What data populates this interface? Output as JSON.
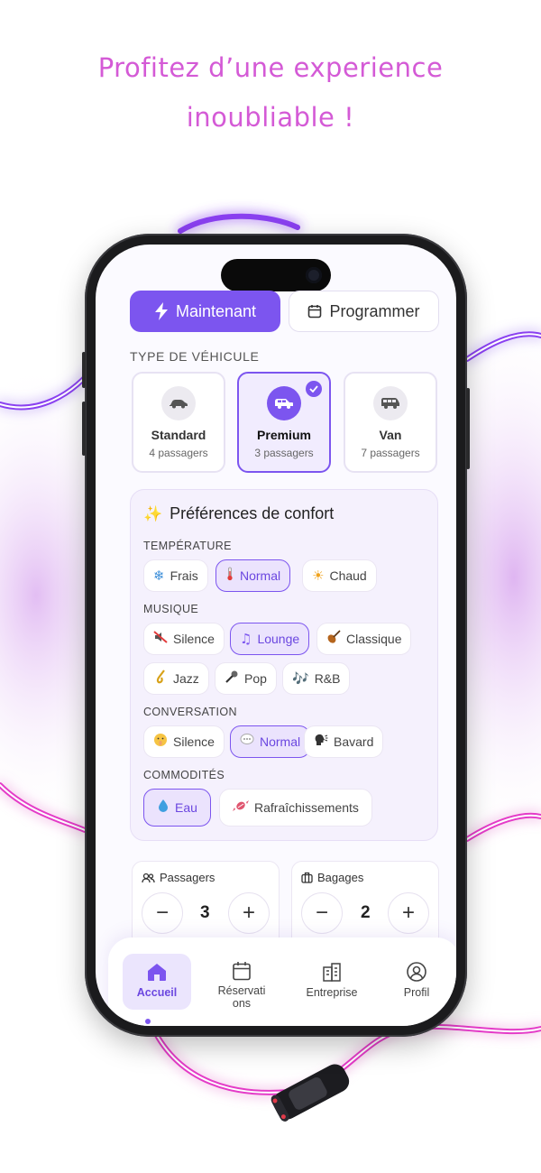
{
  "headline": {
    "line1": "Profitez d’une experience",
    "line2": "inoubliable !"
  },
  "mode": {
    "now_label": "Maintenant",
    "schedule_label": "Programmer",
    "selected": "Maintenant"
  },
  "vehicle": {
    "section_label": "TYPE DE VÉHICULE",
    "selected": "Premium",
    "options": [
      {
        "name": "Standard",
        "sub": "4 passagers",
        "icon": "car-icon"
      },
      {
        "name": "Premium",
        "sub": "3 passagers",
        "icon": "suv-icon"
      },
      {
        "name": "Van",
        "sub": "7 passagers",
        "icon": "van-icon"
      }
    ]
  },
  "prefs": {
    "title": "Préférences de confort",
    "title_emoji": "✨",
    "temperature": {
      "label": "TEMPÉRATURE",
      "selected": "Normal",
      "chips": [
        {
          "emoji": "❄",
          "label": "Frais"
        },
        {
          "emoji": "🌡",
          "label": "Normal"
        },
        {
          "emoji": "☀",
          "label": "Chaud"
        }
      ]
    },
    "music": {
      "label": "MUSIQUE",
      "selected": "Lounge",
      "chips": [
        {
          "emoji": "🔇",
          "label": "Silence"
        },
        {
          "emoji": "♫",
          "label": "Lounge"
        },
        {
          "emoji": "🎻",
          "label": "Classique"
        },
        {
          "emoji": "🎷",
          "label": "Jazz"
        },
        {
          "emoji": "🎤",
          "label": "Pop"
        },
        {
          "emoji": "🎶",
          "label": "R&B"
        }
      ]
    },
    "conversation": {
      "label": "CONVERSATION",
      "selected": "Normal",
      "chips": [
        {
          "emoji": "🤫",
          "label": "Silence"
        },
        {
          "emoji": "💬",
          "label": "Normal"
        },
        {
          "emoji": "🗣",
          "label": "Bavard"
        }
      ]
    },
    "amenities": {
      "label": "COMMODITÉS",
      "selected": "Eau",
      "chips": [
        {
          "emoji": "💧",
          "label": "Eau"
        },
        {
          "emoji": "🍬",
          "label": "Rafraîchissements"
        }
      ]
    }
  },
  "passengers": {
    "label": "Passagers",
    "value": "3",
    "minus": "−",
    "plus": "+"
  },
  "luggage": {
    "label": "Bagages",
    "value": "2",
    "minus": "−",
    "plus": "+"
  },
  "tabs": [
    {
      "label": "Accueil",
      "icon": "home-icon",
      "active": true
    },
    {
      "label": "Réservati\nons",
      "icon": "calendar-icon",
      "active": false
    },
    {
      "label": "Entreprise",
      "icon": "building-icon",
      "active": false
    },
    {
      "label": "Profil",
      "icon": "profile-icon",
      "active": false
    }
  ],
  "colors": {
    "accent": "#7c55ef",
    "headline": "#d45ad6",
    "neon": "#c94be0"
  }
}
